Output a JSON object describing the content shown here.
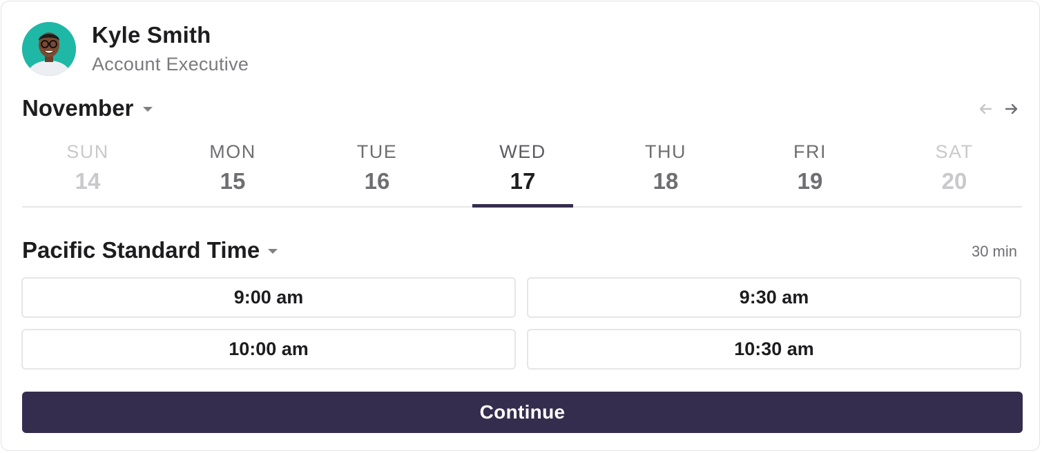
{
  "profile": {
    "name": "Kyle Smith",
    "title": "Account Executive",
    "avatar_icon": "person-avatar",
    "avatar_bg": "#1fb7a6"
  },
  "calendar": {
    "month": "November",
    "prev_icon": "arrow-left-icon",
    "next_icon": "arrow-right-icon",
    "days": [
      {
        "name": "SUN",
        "num": "14",
        "state": "disabled"
      },
      {
        "name": "MON",
        "num": "15",
        "state": "normal"
      },
      {
        "name": "TUE",
        "num": "16",
        "state": "normal"
      },
      {
        "name": "WED",
        "num": "17",
        "state": "selected"
      },
      {
        "name": "THU",
        "num": "18",
        "state": "normal"
      },
      {
        "name": "FRI",
        "num": "19",
        "state": "normal"
      },
      {
        "name": "SAT",
        "num": "20",
        "state": "disabled"
      }
    ]
  },
  "timezone": {
    "label": "Pacific Standard Time",
    "duration": "30 min"
  },
  "slots": [
    "9:00 am",
    "9:30 am",
    "10:00 am",
    "10:30 am"
  ],
  "actions": {
    "continue_label": "Continue"
  },
  "colors": {
    "accent": "#342d4d",
    "divider": "#e6e6e9",
    "muted": "#6e6e73",
    "disabled": "#c9c9cd"
  }
}
